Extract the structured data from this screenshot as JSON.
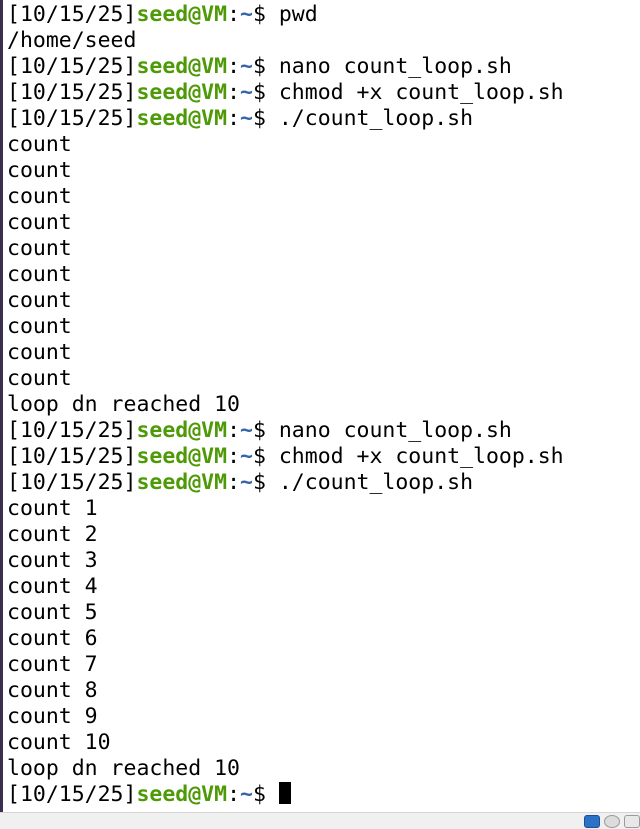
{
  "prompt": {
    "timestamp": "[10/15/25]",
    "user_host": "seed@VM",
    "colon": ":",
    "path": "~",
    "symbol": "$ "
  },
  "lines": [
    {
      "type": "prompt",
      "command": "pwd"
    },
    {
      "type": "output",
      "text": "/home/seed"
    },
    {
      "type": "prompt",
      "command": "nano count_loop.sh"
    },
    {
      "type": "prompt",
      "command": "chmod +x count_loop.sh"
    },
    {
      "type": "prompt",
      "command": "./count_loop.sh"
    },
    {
      "type": "output",
      "text": "count"
    },
    {
      "type": "output",
      "text": "count"
    },
    {
      "type": "output",
      "text": "count"
    },
    {
      "type": "output",
      "text": "count"
    },
    {
      "type": "output",
      "text": "count"
    },
    {
      "type": "output",
      "text": "count"
    },
    {
      "type": "output",
      "text": "count"
    },
    {
      "type": "output",
      "text": "count"
    },
    {
      "type": "output",
      "text": "count"
    },
    {
      "type": "output",
      "text": "count"
    },
    {
      "type": "output",
      "text": "loop dn reached 10"
    },
    {
      "type": "prompt",
      "command": "nano count_loop.sh"
    },
    {
      "type": "prompt",
      "command": "chmod +x count_loop.sh"
    },
    {
      "type": "prompt",
      "command": "./count_loop.sh"
    },
    {
      "type": "output",
      "text": "count 1"
    },
    {
      "type": "output",
      "text": "count 2"
    },
    {
      "type": "output",
      "text": "count 3"
    },
    {
      "type": "output",
      "text": "count 4"
    },
    {
      "type": "output",
      "text": "count 5"
    },
    {
      "type": "output",
      "text": "count 6"
    },
    {
      "type": "output",
      "text": "count 7"
    },
    {
      "type": "output",
      "text": "count 8"
    },
    {
      "type": "output",
      "text": "count 9"
    },
    {
      "type": "output",
      "text": "count 10"
    },
    {
      "type": "output",
      "text": "loop dn reached 10"
    },
    {
      "type": "prompt",
      "command": "",
      "cursor": true
    }
  ],
  "colors": {
    "background": "#ffffff",
    "text": "#000000",
    "user_host": "#4e9a06",
    "path": "#3465a4"
  },
  "status_icons": [
    "vm-network-icon",
    "vm-optical-drive-icon",
    "vm-usb-icon"
  ]
}
